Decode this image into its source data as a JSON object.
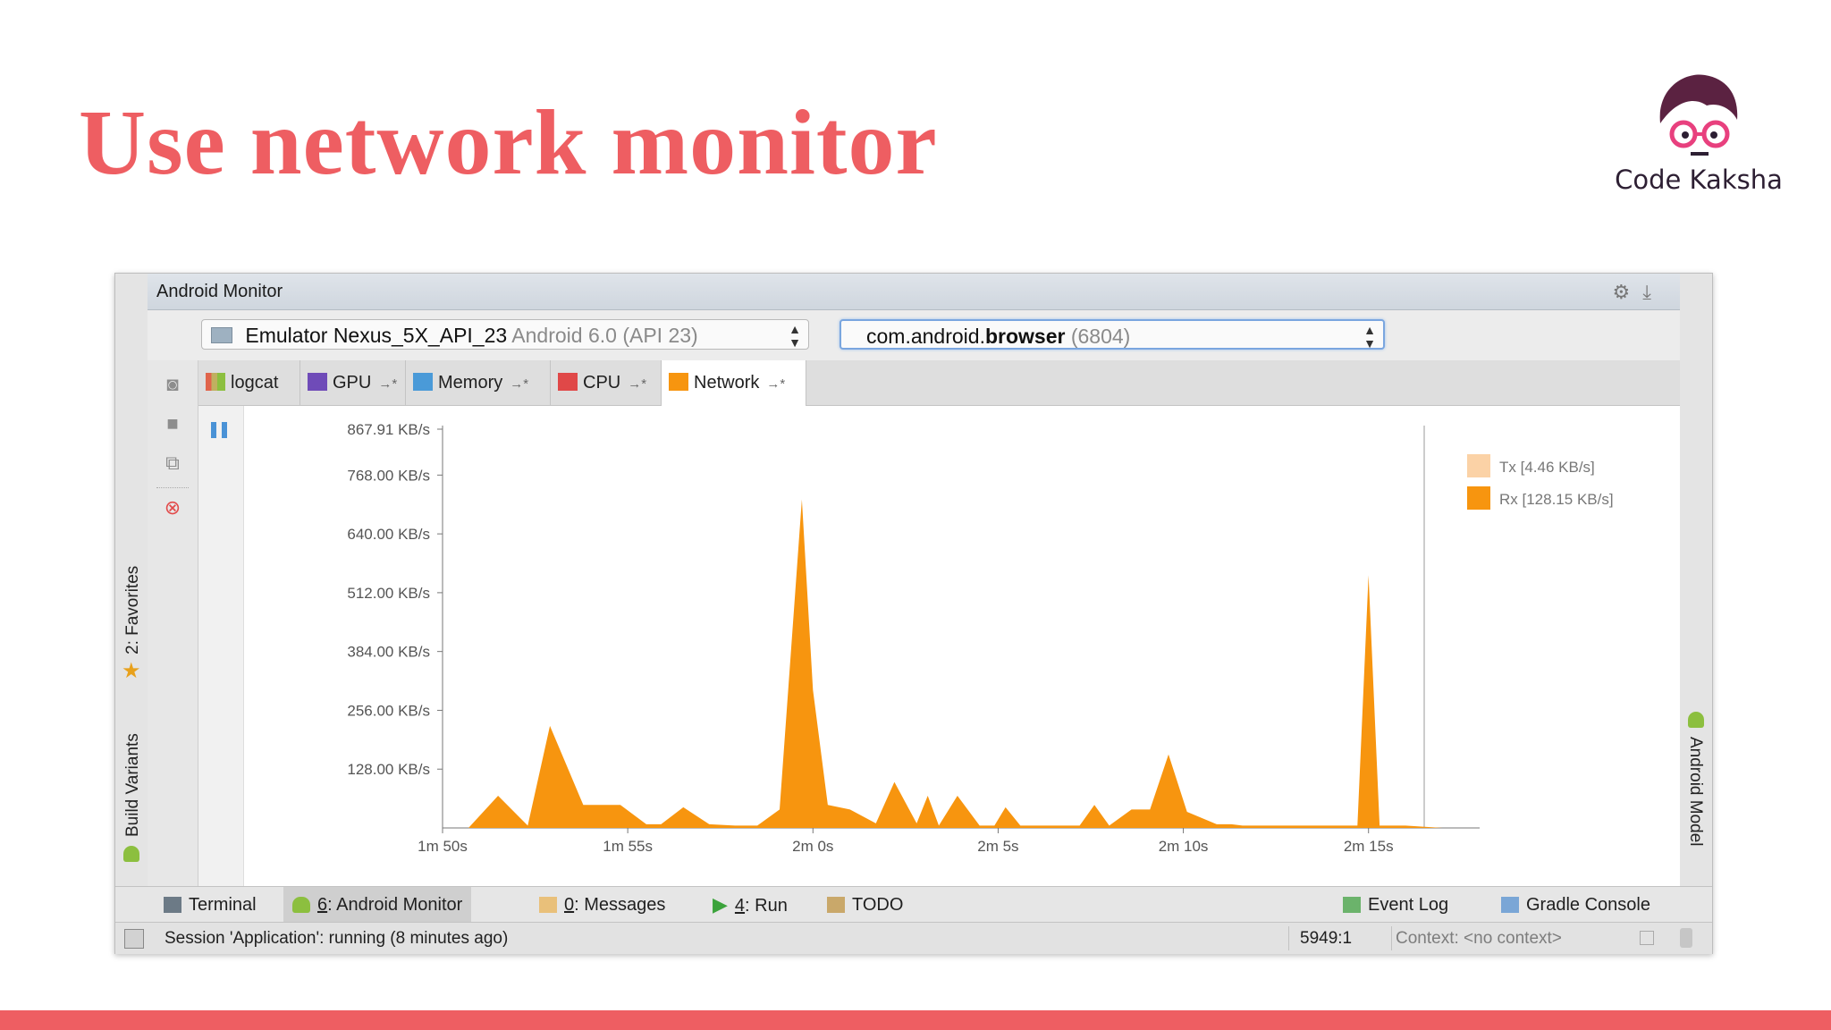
{
  "slide": {
    "title": "Use network monitor"
  },
  "logo": {
    "text": "Code Kaksha"
  },
  "ide": {
    "panel_title": "Android Monitor",
    "device": {
      "name": "Emulator Nexus_5X_API_23",
      "version": "Android 6.0 (API 23)"
    },
    "process": {
      "prefix": "com.android.",
      "bold": "browser",
      "pid": "(6804)"
    },
    "left_tabs": {
      "favorites": "2: Favorites",
      "build_variants": "Build Variants"
    },
    "right_tabs": {
      "android_model": "Android Model"
    },
    "tabs": [
      {
        "label": "logcat",
        "color": "#c0b060"
      },
      {
        "label": "GPU",
        "color": "#6f4bb8"
      },
      {
        "label": "Memory",
        "color": "#4a9ad8"
      },
      {
        "label": "CPU",
        "color": "#e04848"
      },
      {
        "label": "Network",
        "color": "#f7950f"
      }
    ],
    "bottom_tabs": [
      {
        "num": "",
        "label": "Terminal"
      },
      {
        "num": "6",
        "label": ": Android Monitor"
      },
      {
        "num": "0",
        "label": ": Messages"
      },
      {
        "num": "4",
        "label": ": Run"
      },
      {
        "num": "",
        "label": "TODO"
      },
      {
        "num": "",
        "label": "Event Log"
      },
      {
        "num": "",
        "label": "Gradle Console"
      }
    ],
    "status": {
      "message": "Session 'Application': running (8 minutes ago)",
      "position": "5949:1",
      "context": "Context: <no context>"
    },
    "icons": [
      "gear-icon",
      "download-icon",
      "camera-icon",
      "stop-icon",
      "screen-record-icon",
      "close-icon",
      "pause-icon",
      "android-icon",
      "star-icon"
    ]
  },
  "chart_data": {
    "type": "area",
    "ylim": [
      0,
      867.91
    ],
    "y_ticks": [
      "867.91 KB/s",
      "768.00 KB/s",
      "640.00 KB/s",
      "512.00 KB/s",
      "384.00 KB/s",
      "256.00 KB/s",
      "128.00 KB/s"
    ],
    "y_tick_values": [
      867.91,
      768,
      640,
      512,
      384,
      256,
      128
    ],
    "x_ticks": [
      "1m 50s",
      "1m 55s",
      "2m 0s",
      "2m 5s",
      "2m 10s",
      "2m 15s"
    ],
    "x_tick_values": [
      110,
      115,
      120,
      125,
      130,
      135
    ],
    "xlim": [
      110,
      138
    ],
    "legend": [
      {
        "label": "Tx [4.46 KB/s]",
        "color": "#fbd2a6"
      },
      {
        "label": "Rx [128.15 KB/s]",
        "color": "#f7950f"
      }
    ],
    "series": [
      {
        "name": "Rx",
        "color": "#f7950f",
        "x": [
          110.0,
          110.7,
          111.5,
          112.3,
          112.9,
          113.8,
          114.8,
          115.5,
          115.9,
          116.5,
          117.2,
          117.9,
          118.5,
          119.1,
          119.7,
          120.0,
          120.4,
          121.0,
          121.7,
          122.2,
          122.8,
          123.1,
          123.4,
          123.9,
          124.5,
          124.9,
          125.2,
          125.6,
          126.3,
          126.7,
          127.2,
          127.6,
          128.0,
          128.6,
          129.1,
          129.6,
          130.1,
          130.9,
          131.3,
          131.6,
          132.6,
          133.7,
          134.1,
          134.5,
          134.7,
          135.0,
          135.3,
          135.6,
          136.0,
          137.0,
          138.0
        ],
        "y": [
          0,
          0,
          70,
          5,
          222,
          50,
          50,
          8,
          8,
          45,
          8,
          5,
          5,
          40,
          715,
          300,
          50,
          40,
          10,
          100,
          10,
          70,
          5,
          70,
          5,
          5,
          45,
          5,
          5,
          5,
          5,
          50,
          5,
          40,
          40,
          160,
          35,
          8,
          8,
          5,
          5,
          5,
          5,
          5,
          5,
          550,
          5,
          5,
          5,
          0,
          0
        ]
      },
      {
        "name": "Tx",
        "color": "#fbd2a6",
        "x": [
          110.0,
          138.0
        ],
        "y": [
          0,
          0
        ]
      }
    ]
  }
}
